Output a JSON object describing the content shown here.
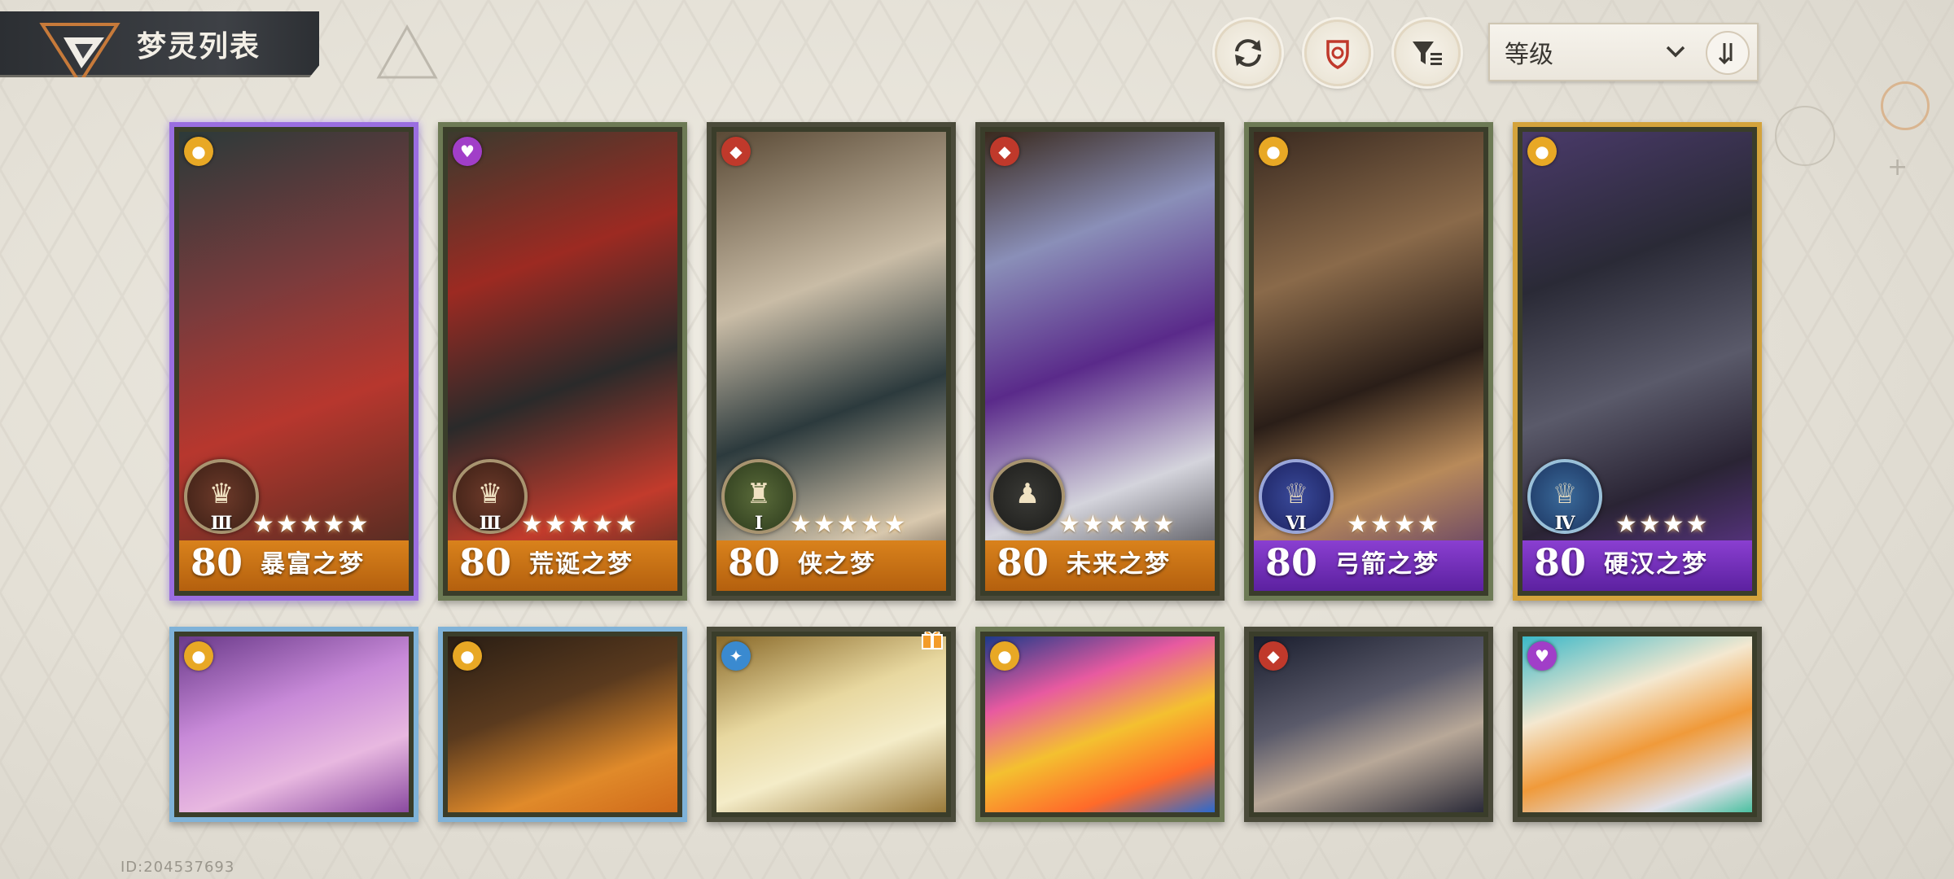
{
  "header": {
    "title": "梦灵列表",
    "buttons": [
      {
        "name": "refresh-button",
        "icon": "refresh-icon"
      },
      {
        "name": "element-filter-button",
        "icon": "target-icon"
      },
      {
        "name": "filter-button",
        "icon": "filter-icon"
      }
    ],
    "sort": {
      "label": "等级",
      "icon": "chevron-down-icon",
      "order_icon": "sort-order-icon"
    }
  },
  "cards_row1": [
    {
      "level": "80",
      "name": "暴富之梦",
      "stars": "★★★★★",
      "badge": "Ⅲ",
      "element": "gold",
      "rarity": "gold"
    },
    {
      "level": "80",
      "name": "荒诞之梦",
      "stars": "★★★★★",
      "badge": "Ⅲ",
      "element": "purple",
      "rarity": "gold"
    },
    {
      "level": "80",
      "name": "侠之梦",
      "stars": "★★★★★",
      "badge": "Ⅰ",
      "element": "red",
      "rarity": "gold"
    },
    {
      "level": "80",
      "name": "未来之梦",
      "stars": "★★★★★",
      "badge": "",
      "element": "red",
      "rarity": "gold"
    },
    {
      "level": "80",
      "name": "弓箭之梦",
      "stars": "★★★★",
      "badge": "Ⅵ",
      "element": "gold",
      "rarity": "purple"
    },
    {
      "level": "80",
      "name": "硬汉之梦",
      "stars": "★★★★",
      "badge": "Ⅳ",
      "element": "gold",
      "rarity": "purple"
    }
  ],
  "cards_row2": [
    {
      "element": "gold"
    },
    {
      "element": "gold"
    },
    {
      "element": "blue"
    },
    {
      "element": "gold"
    },
    {
      "element": "red"
    },
    {
      "element": "purple"
    }
  ],
  "footer": {
    "player_id": "ID:204537693"
  },
  "colors": {
    "gold_footer": "#d9821c",
    "purple_footer": "#8a3fd1",
    "card_border_green": "#6d7a55",
    "card_border_gold": "#d4a33c",
    "card_border_purple": "#9a6ee0",
    "card_border_blue": "#7fb2d8"
  }
}
